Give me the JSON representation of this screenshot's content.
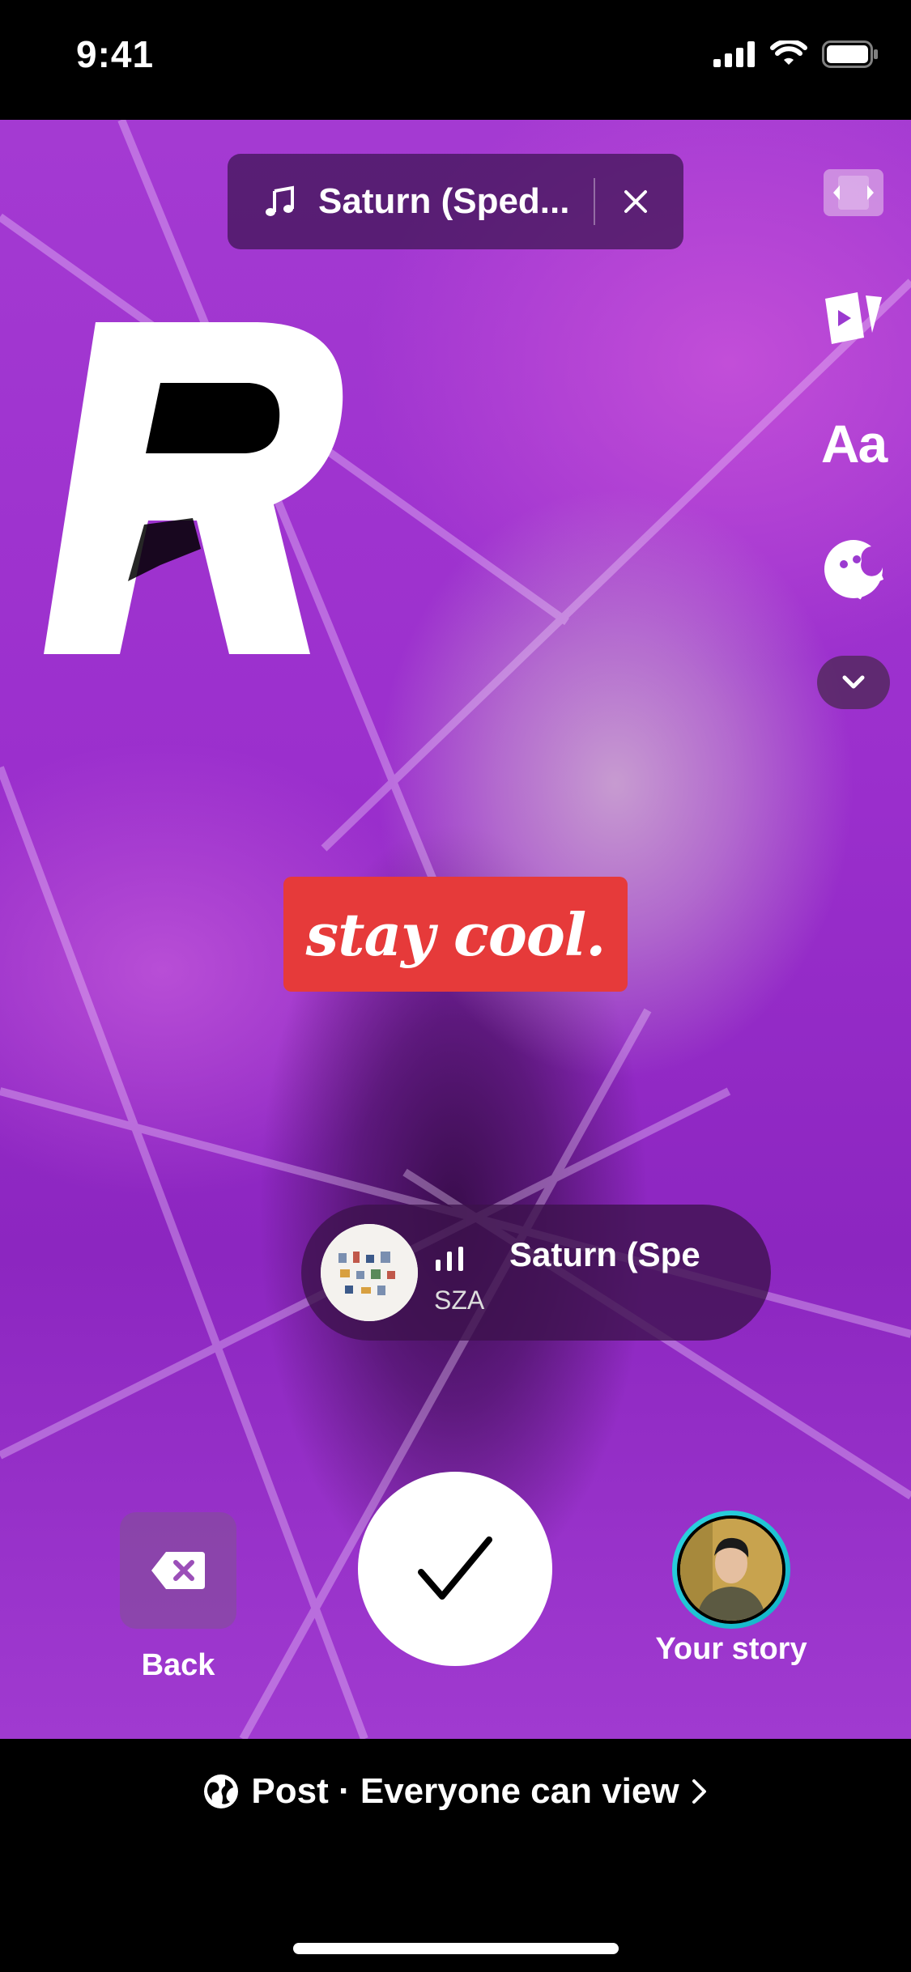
{
  "status_bar": {
    "time": "9:41",
    "icons": [
      "cellular-signal-icon",
      "wifi-icon",
      "battery-icon"
    ]
  },
  "music_bar": {
    "icon": "music-note-icon",
    "title": "Saturn (Sped...",
    "close_icon": "close-icon"
  },
  "side_tools": {
    "items": [
      {
        "name": "resize-icon"
      },
      {
        "name": "clips-icon"
      },
      {
        "name": "text-tool",
        "label": "Aa"
      },
      {
        "name": "sticker-icon"
      },
      {
        "name": "chevron-down-icon"
      }
    ]
  },
  "stickers": {
    "letter": "R",
    "text_sticker": "stay cool.",
    "music_sticker": {
      "title": "Saturn (Spe",
      "artist": "SZA"
    }
  },
  "actions": {
    "back_label": "Back",
    "story_label": "Your story"
  },
  "footer": {
    "post_text": "Post · Everyone can view"
  },
  "colors": {
    "accent_red": "#e63a3a",
    "story_ring": "#2ed3e0",
    "background_purple": "#a43ad2"
  }
}
